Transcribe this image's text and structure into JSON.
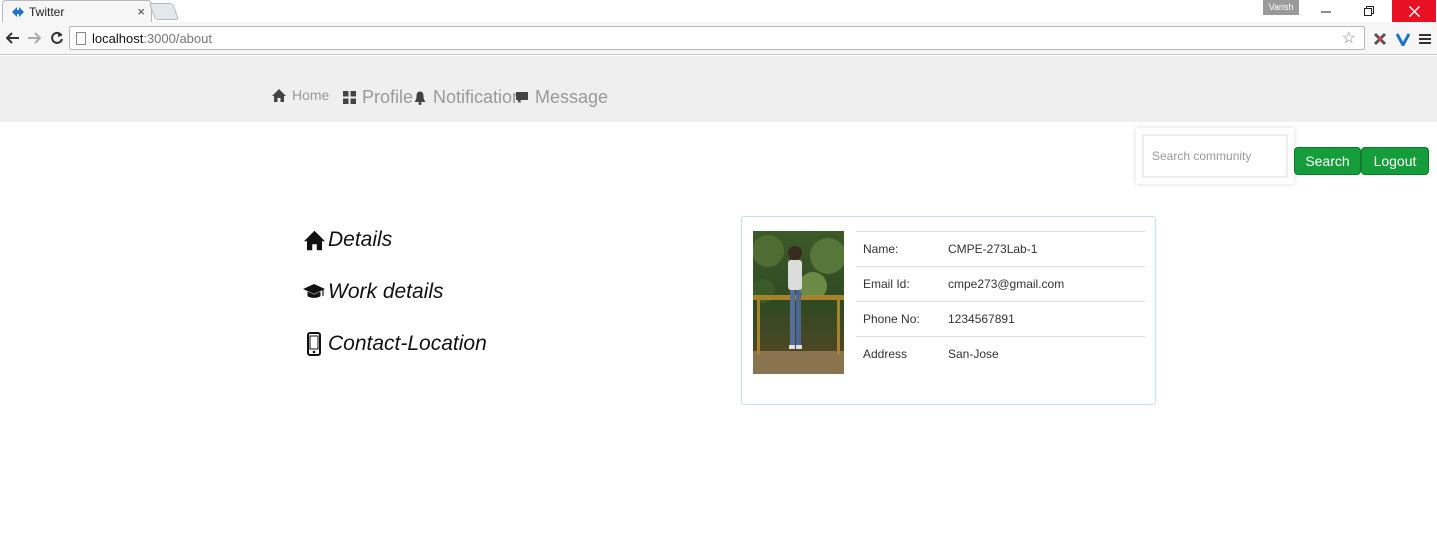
{
  "browser": {
    "tab_title": "Twitter",
    "tab_close": "×",
    "user_badge": "Varish",
    "url_host": "localhost",
    "url_path": ":3000/about"
  },
  "nav": {
    "home": "Home",
    "profile": "Profile",
    "notification": "Notification",
    "message": "Message"
  },
  "search": {
    "placeholder": "Search community",
    "search_label": "Search",
    "logout_label": "Logout"
  },
  "menu": {
    "details": "Details",
    "work": "Work details",
    "contact": "Contact-Location"
  },
  "profile": {
    "rows": [
      {
        "label": "Name:",
        "value": "CMPE-273Lab-1"
      },
      {
        "label": "Email Id:",
        "value": "cmpe273@gmail.com"
      },
      {
        "label": "Phone No:",
        "value": "1234567891"
      },
      {
        "label": "Address",
        "value": "San-Jose"
      }
    ]
  },
  "colors": {
    "accent_green": "#149d3a",
    "nav_bg": "#efefef",
    "nav_text": "#999999",
    "card_border": "#c4e3e6"
  },
  "icons": {
    "home": "home-icon",
    "profile": "grid-icon",
    "notification": "bell-icon",
    "message": "comment-icon",
    "details": "home-icon",
    "work": "graduation-cap-icon",
    "contact": "mobile-phone-icon"
  }
}
